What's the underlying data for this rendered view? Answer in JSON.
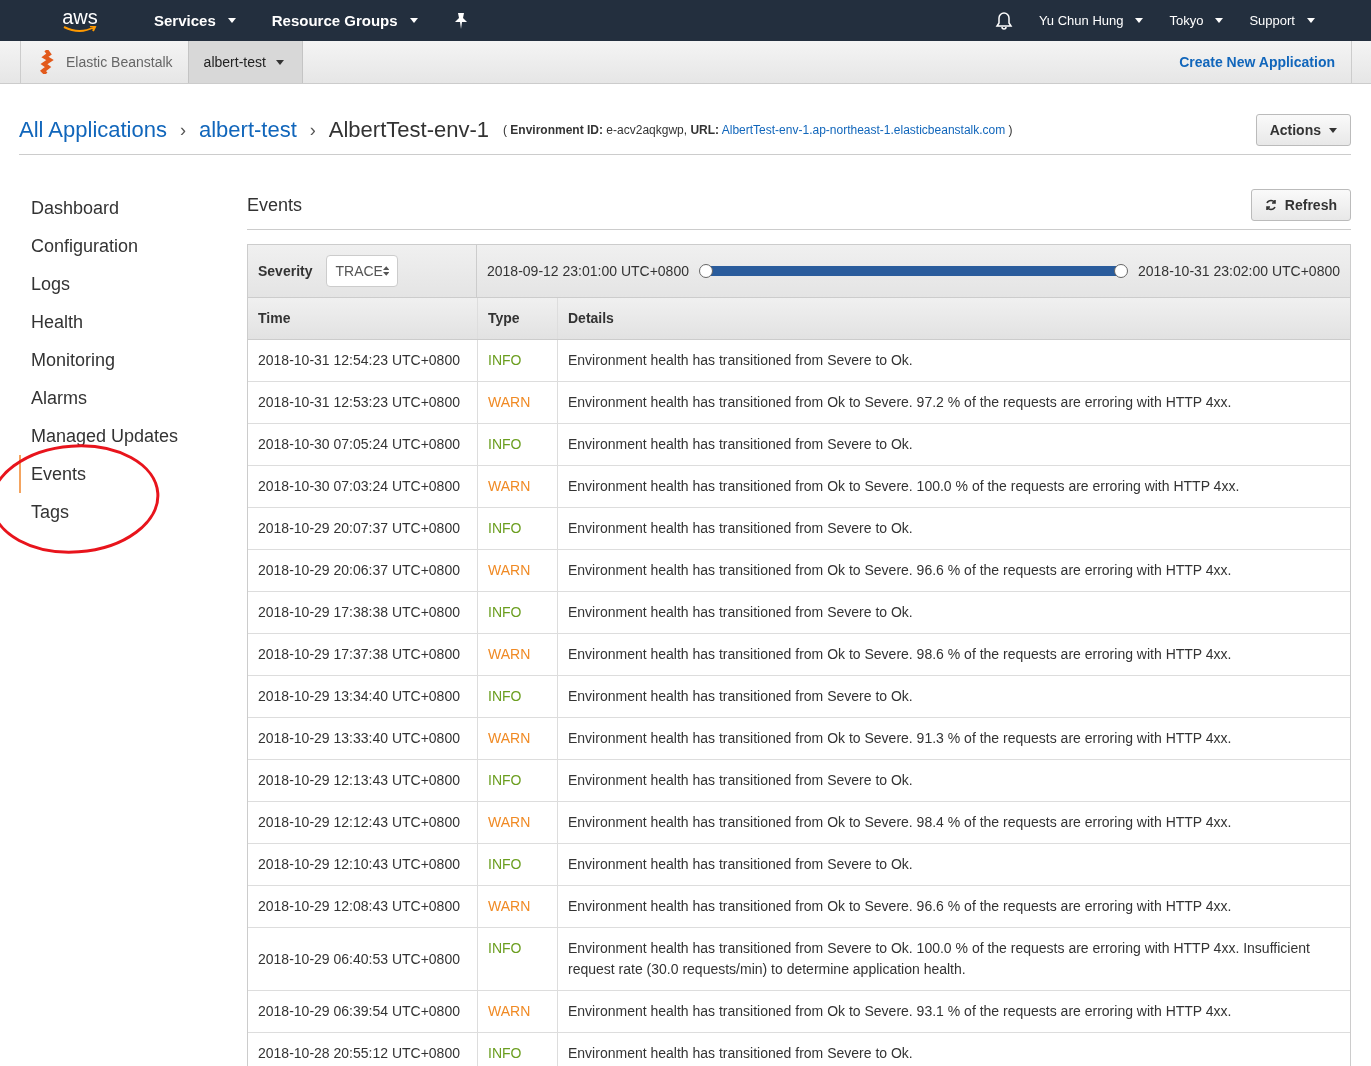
{
  "top_nav": {
    "logo": "aws",
    "menus": [
      {
        "label": "Services"
      },
      {
        "label": "Resource Groups"
      }
    ],
    "right_menus": [
      {
        "label": "Yu Chun Hung"
      },
      {
        "label": "Tokyo"
      },
      {
        "label": "Support"
      }
    ]
  },
  "sub_nav": {
    "service": "Elastic Beanstalk",
    "app": "albert-test",
    "create_link": "Create New Application"
  },
  "breadcrumb": {
    "items": [
      "All Applications",
      "albert-test"
    ],
    "separator": "›",
    "current": "AlbertTest-env-1",
    "env_open": "(",
    "env_id_label": "Environment ID:",
    "env_id": "e-acv2aqkgwp,",
    "url_label": "URL:",
    "url": "AlbertTest-env-1.ap-northeast-1.elasticbeanstalk.com",
    "env_close": ")",
    "actions": "Actions"
  },
  "sidebar": {
    "items": [
      {
        "label": "Dashboard",
        "selected": false
      },
      {
        "label": "Configuration",
        "selected": false
      },
      {
        "label": "Logs",
        "selected": false
      },
      {
        "label": "Health",
        "selected": false
      },
      {
        "label": "Monitoring",
        "selected": false
      },
      {
        "label": "Alarms",
        "selected": false
      },
      {
        "label": "Managed Updates",
        "selected": false
      },
      {
        "label": "Events",
        "selected": true
      },
      {
        "label": "Tags",
        "selected": false
      }
    ]
  },
  "events": {
    "title": "Events",
    "refresh": "Refresh",
    "severity_label": "Severity",
    "severity_value": "TRACE",
    "range_start": "2018-09-12 23:01:00 UTC+0800",
    "range_end": "2018-10-31 23:02:00 UTC+0800",
    "range": {
      "level": 1
    },
    "columns": [
      "Time",
      "Type",
      "Details"
    ],
    "rows": [
      {
        "time": "2018-10-31 12:54:23 UTC+0800",
        "type": "INFO",
        "kind": "info",
        "details": "Environment health has transitioned from Severe to Ok."
      },
      {
        "time": "2018-10-31 12:53:23 UTC+0800",
        "type": "WARN",
        "kind": "warn",
        "details": "Environment health has transitioned from Ok to Severe. 97.2 % of the requests are erroring with HTTP 4xx."
      },
      {
        "time": "2018-10-30 07:05:24 UTC+0800",
        "type": "INFO",
        "kind": "info",
        "details": "Environment health has transitioned from Severe to Ok."
      },
      {
        "time": "2018-10-30 07:03:24 UTC+0800",
        "type": "WARN",
        "kind": "warn",
        "details": "Environment health has transitioned from Ok to Severe. 100.0 % of the requests are erroring with HTTP 4xx."
      },
      {
        "time": "2018-10-29 20:07:37 UTC+0800",
        "type": "INFO",
        "kind": "info",
        "details": "Environment health has transitioned from Severe to Ok."
      },
      {
        "time": "2018-10-29 20:06:37 UTC+0800",
        "type": "WARN",
        "kind": "warn",
        "details": "Environment health has transitioned from Ok to Severe. 96.6 % of the requests are erroring with HTTP 4xx."
      },
      {
        "time": "2018-10-29 17:38:38 UTC+0800",
        "type": "INFO",
        "kind": "info",
        "details": "Environment health has transitioned from Severe to Ok."
      },
      {
        "time": "2018-10-29 17:37:38 UTC+0800",
        "type": "WARN",
        "kind": "warn",
        "details": "Environment health has transitioned from Ok to Severe. 98.6 % of the requests are erroring with HTTP 4xx."
      },
      {
        "time": "2018-10-29 13:34:40 UTC+0800",
        "type": "INFO",
        "kind": "info",
        "details": "Environment health has transitioned from Severe to Ok."
      },
      {
        "time": "2018-10-29 13:33:40 UTC+0800",
        "type": "WARN",
        "kind": "warn",
        "details": "Environment health has transitioned from Ok to Severe. 91.3 % of the requests are erroring with HTTP 4xx."
      },
      {
        "time": "2018-10-29 12:13:43 UTC+0800",
        "type": "INFO",
        "kind": "info",
        "details": "Environment health has transitioned from Severe to Ok."
      },
      {
        "time": "2018-10-29 12:12:43 UTC+0800",
        "type": "WARN",
        "kind": "warn",
        "details": "Environment health has transitioned from Ok to Severe. 98.4 % of the requests are erroring with HTTP 4xx."
      },
      {
        "time": "2018-10-29 12:10:43 UTC+0800",
        "type": "INFO",
        "kind": "info",
        "details": "Environment health has transitioned from Severe to Ok."
      },
      {
        "time": "2018-10-29 12:08:43 UTC+0800",
        "type": "WARN",
        "kind": "warn",
        "details": "Environment health has transitioned from Ok to Severe. 96.6 % of the requests are erroring with HTTP 4xx."
      },
      {
        "time": "2018-10-29 06:40:53 UTC+0800",
        "type": "INFO",
        "kind": "info",
        "details": "Environment health has transitioned from Severe to Ok. 100.0 % of the requests are erroring with HTTP 4xx. Insufficient request rate (30.0 requests/min) to determine application health."
      },
      {
        "time": "2018-10-29 06:39:54 UTC+0800",
        "type": "WARN",
        "kind": "warn",
        "details": "Environment health has transitioned from Ok to Severe. 93.1 % of the requests are erroring with HTTP 4xx."
      },
      {
        "time": "2018-10-28 20:55:12 UTC+0800",
        "type": "INFO",
        "kind": "info",
        "details": "Environment health has transitioned from Severe to Ok."
      }
    ]
  }
}
